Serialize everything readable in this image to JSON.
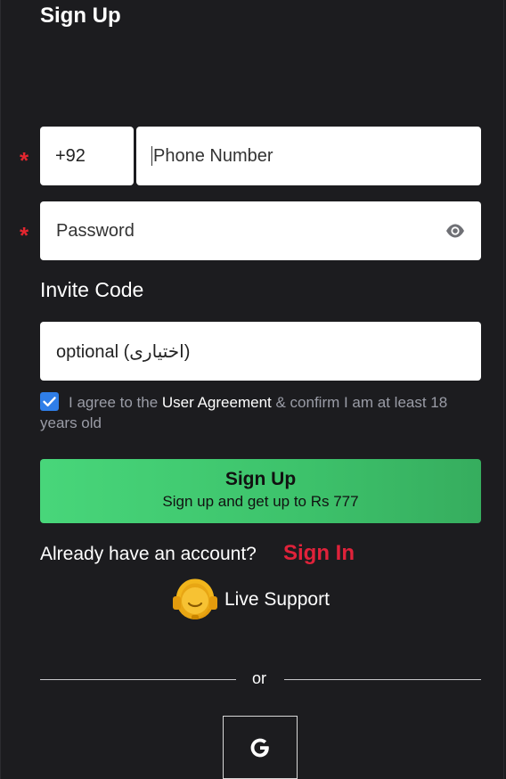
{
  "header": {
    "title": "Sign Up"
  },
  "form": {
    "required_mark": "*",
    "country_code": "+92",
    "phone_placeholder": "Phone Number",
    "password_placeholder": "Password",
    "invite_label": "Invite Code",
    "invite_placeholder": "optional  (اختیاری)",
    "agreement": {
      "checked": true,
      "prefix": "I agree to the ",
      "link": "User Agreement",
      "suffix": " & confirm I am at least 18 years old"
    },
    "submit": {
      "label": "Sign Up",
      "sublabel": "Sign up and get up to Rs 777"
    }
  },
  "account": {
    "prompt": "Already have an account?",
    "signin_label": "Sign In"
  },
  "support": {
    "label": "Live Support",
    "icon": "headset-icon"
  },
  "social": {
    "divider": "or",
    "google_icon": "google-icon"
  },
  "colors": {
    "background": "#1c1c1f",
    "required": "#e3262f",
    "signin": "#e0223a",
    "button_start": "#48d67a",
    "button_end": "#36ad5e",
    "checkbox": "#2f7ee8"
  }
}
